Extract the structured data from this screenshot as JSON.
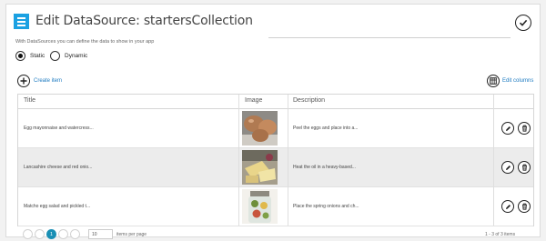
{
  "header": {
    "title": "Edit DataSource: startersCollection",
    "description": "With DataSources you can define the data to show in your app"
  },
  "source_type": {
    "options": [
      {
        "label": "Static",
        "selected": true
      },
      {
        "label": "Dynamic",
        "selected": false
      }
    ]
  },
  "actions": {
    "create_item": "Create item",
    "edit_columns": "Edit columns"
  },
  "grid": {
    "columns": [
      "Title",
      "Image",
      "Description"
    ],
    "rows": [
      {
        "title": "Egg mayonnaise and watercress...",
        "image": "eggs-photo",
        "description": "Peel the eggs and place into a..."
      },
      {
        "title": "Lancashire cheese and red onio...",
        "image": "cheese-photo",
        "description": "Heat the oil in a heavy-based..."
      },
      {
        "title": "Matcho egg salad and pickled t...",
        "image": "pickle-jar-photo",
        "description": "Place the spring onions and ch..."
      }
    ]
  },
  "pager": {
    "current_page": "1",
    "page_size": "10",
    "items_per_page_label": "items per page",
    "summary": "1 - 3 of 3 items"
  },
  "colors": {
    "accent": "#1ba1e2",
    "link": "#1e7bc1",
    "pager_active": "#1a8fb4"
  }
}
